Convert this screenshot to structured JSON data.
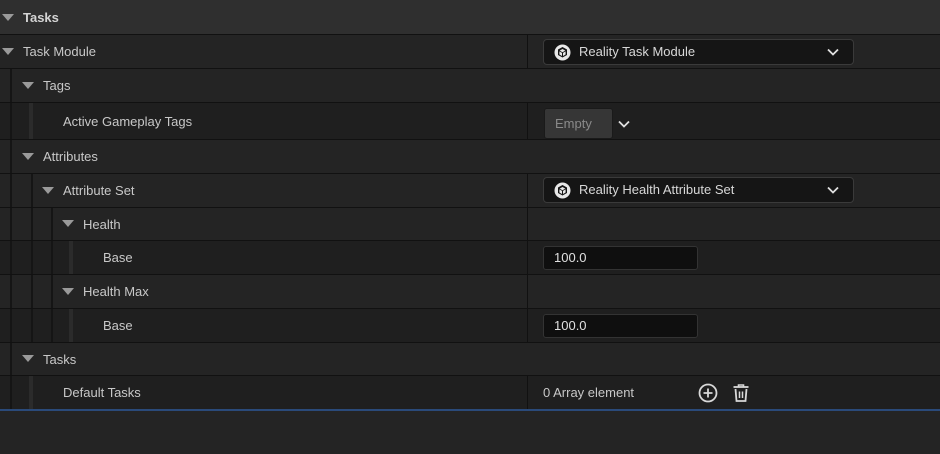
{
  "panel": {
    "section_title": "Tasks",
    "task_module": {
      "label": "Task Module",
      "value": "Reality Task Module"
    },
    "tags": {
      "label": "Tags",
      "active_gameplay_tags_label": "Active Gameplay Tags",
      "active_gameplay_tags_value": "Empty"
    },
    "attributes": {
      "label": "Attributes",
      "attribute_set_label": "Attribute Set",
      "attribute_set_value": "Reality Health Attribute Set",
      "health_label": "Health",
      "health_base_label": "Base",
      "health_base_value": "100.0",
      "health_max_label": "Health Max",
      "health_max_base_label": "Base",
      "health_max_base_value": "100.0"
    },
    "tasks": {
      "label": "Tasks",
      "default_tasks_label": "Default Tasks",
      "default_tasks_value": "0 Array element"
    }
  },
  "icons": {
    "asset_icon": "unreal-asset-icon",
    "dropdown": "chevron-down-icon",
    "add": "add-circle-icon",
    "delete": "trash-icon"
  },
  "colors": {
    "background": "#242424",
    "category_header": "#2f2f2f",
    "accent_line": "#2a4a7a"
  }
}
